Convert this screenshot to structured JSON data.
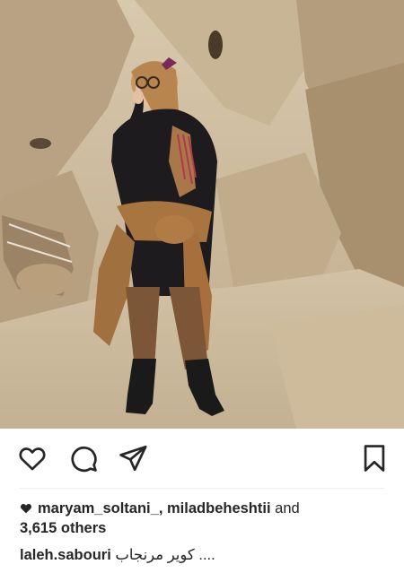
{
  "post": {
    "image_alt": "Woman in dark outfit standing among adobe ruins"
  },
  "actions": {
    "like_icon": "heart-outline-icon",
    "comment_icon": "comment-bubble-icon",
    "share_icon": "paper-plane-icon",
    "save_icon": "bookmark-outline-icon"
  },
  "likes": {
    "user1": "maryam_soltani_",
    "separator": ",",
    "user2": "miladbeheshtii",
    "and_text": "and",
    "others": "3,615 others"
  },
  "caption": {
    "username": "laleh.sabouri",
    "text": "کویر مرنجاب ...."
  },
  "colors": {
    "text": "#262626",
    "icon": "#262626",
    "background": "#ffffff"
  }
}
